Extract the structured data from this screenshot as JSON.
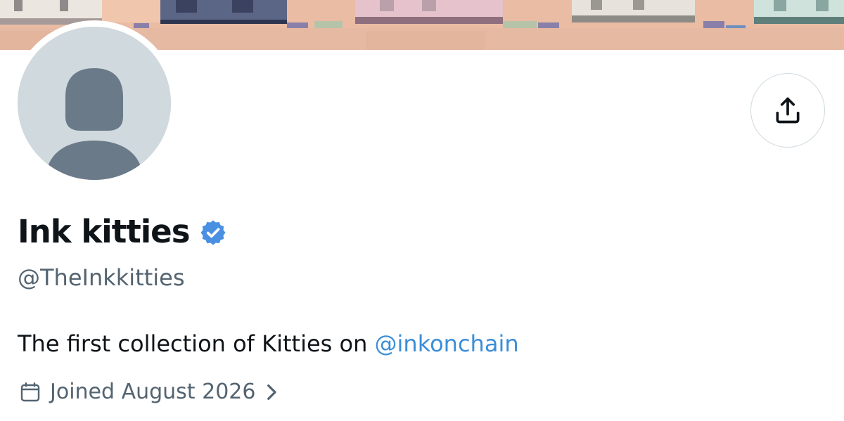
{
  "profile": {
    "display_name": "Ink kitties",
    "handle": "@TheInkkitties",
    "bio_text": "The first collection of Kitties on ",
    "bio_mention": "@inkonchain",
    "joined_label": "Joined August 2026",
    "verified": true
  },
  "icons": {
    "share": "share-upload-icon",
    "verified": "verified-badge-icon",
    "calendar": "calendar-icon",
    "chevron": "chevron-right-icon"
  },
  "colors": {
    "verified_blue": "#4a90e2",
    "mention_blue": "#3b8ed8",
    "secondary_text": "#536471",
    "avatar_bg": "#cfd9de",
    "avatar_silhouette": "#6b7a89",
    "banner_base": "#e8b8a0"
  }
}
